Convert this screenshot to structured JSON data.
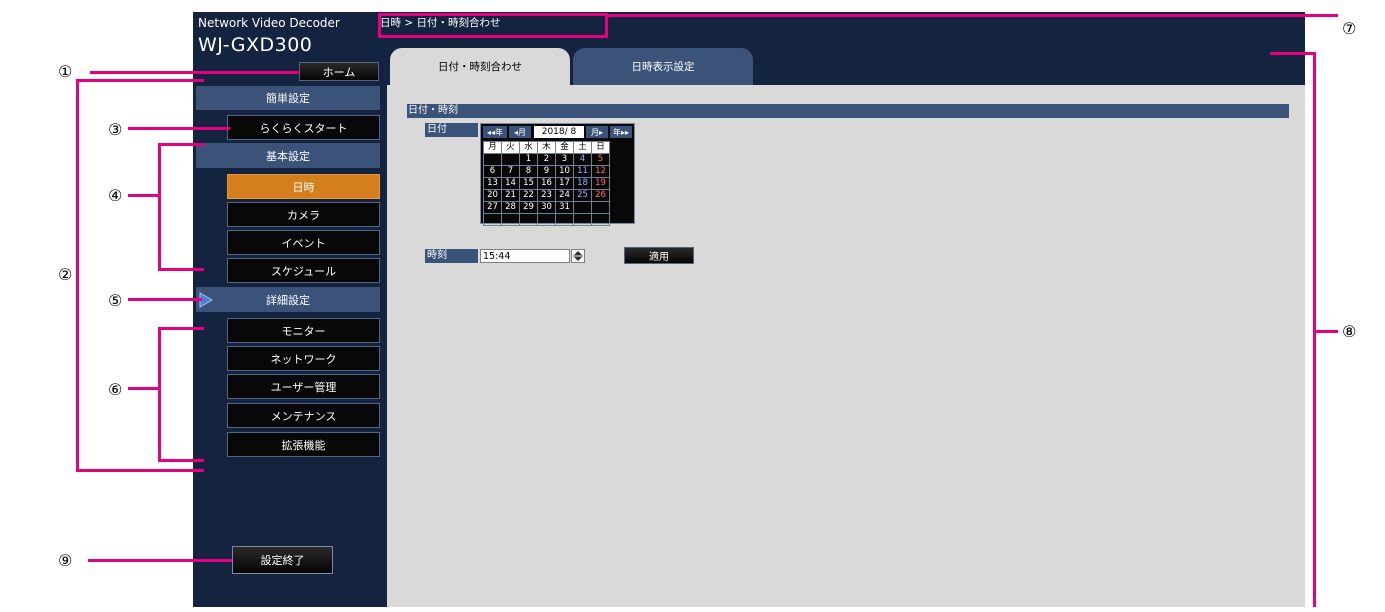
{
  "app": {
    "line1": "Network Video Decoder",
    "line2": "WJ-GXD300"
  },
  "sidebar": {
    "home_label": "ホーム",
    "easy_section": "簡単設定",
    "easy_start": "らくらくスタート",
    "basic_section": "基本設定",
    "basic_items": [
      "日時",
      "カメラ",
      "イベント",
      "スケジュール"
    ],
    "advanced_section": "詳細設定",
    "advanced_items": [
      "モニター",
      "ネットワーク",
      "ユーザー管理",
      "メンテナンス",
      "拡張機能"
    ],
    "exit_label": "設定終了"
  },
  "header": {
    "breadcrumb": "日時 > 日付・時刻合わせ"
  },
  "tabs": [
    {
      "label": "日付・時刻合わせ",
      "active": true
    },
    {
      "label": "日時表示設定",
      "active": false
    }
  ],
  "main": {
    "section_title": "日付・時刻",
    "date_label": "日付",
    "time_label": "時刻",
    "time_value": "15:44",
    "apply_label": "適用"
  },
  "calendar": {
    "nav_prev_year": "◂◂年",
    "nav_prev_month": "◂月",
    "month_display": "2018/ 8",
    "nav_next_month": "月▸",
    "nav_next_year": "年▸▸",
    "weekdays": [
      "月",
      "火",
      "水",
      "木",
      "金",
      "土",
      "日"
    ],
    "weeks": [
      [
        "",
        "",
        "1",
        "2",
        "3",
        "4",
        "5"
      ],
      [
        "6",
        "7",
        "8",
        "9",
        "10",
        "11",
        "12"
      ],
      [
        "13",
        "14",
        "15",
        "16",
        "17",
        "18",
        "19"
      ],
      [
        "20",
        "21",
        "22",
        "23",
        "24",
        "25",
        "26"
      ],
      [
        "27",
        "28",
        "29",
        "30",
        "31",
        "",
        ""
      ],
      [
        "",
        "",
        "",
        "",
        "",
        "",
        ""
      ]
    ]
  },
  "callouts": [
    "①",
    "②",
    "③",
    "④",
    "⑤",
    "⑥",
    "⑦",
    "⑧",
    "⑨"
  ],
  "colors": {
    "sidebar_bg": "#142440",
    "section_bar": "#3b5378",
    "active_orange": "#d47f1c",
    "content_bg": "#d9d9d9",
    "callout_pink": "#e6007e"
  }
}
